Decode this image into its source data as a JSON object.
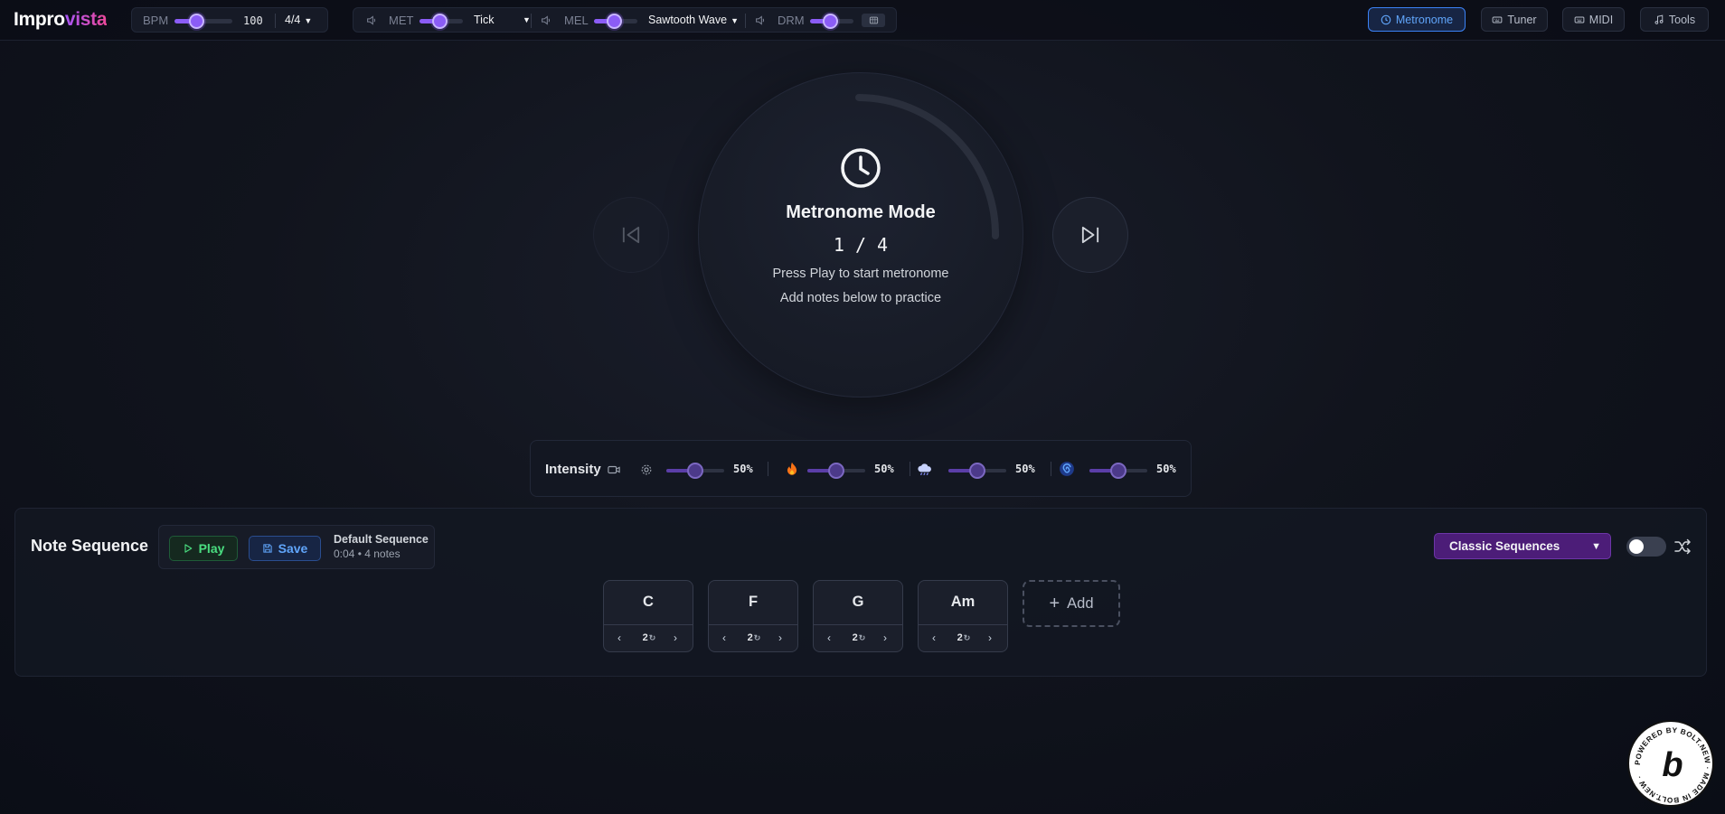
{
  "app": {
    "title_part1": "Impro",
    "title_part2": "vista"
  },
  "top": {
    "bpm_label": "BPM",
    "bpm_value": "100",
    "bpm_level": 0.4,
    "time_signature": "4/4",
    "met_label": "MET",
    "met_sound": "Tick",
    "met_volume": 0.5,
    "mel_label": "MEL",
    "mel_sound": "Sawtooth Wave",
    "mel_volume": 0.5,
    "drm_label": "DRM",
    "drm_volume": 0.5
  },
  "nav": {
    "metronome": "Metronome",
    "tuner": "Tuner",
    "midi": "MIDI",
    "tools": "Tools"
  },
  "main": {
    "mode_title": "Metronome Mode",
    "counter": "1 / 4",
    "hint_1": "Press Play to start metronome",
    "hint_2": "Add notes below to practice"
  },
  "intensity": {
    "label": "Intensity",
    "controls": [
      {
        "icon": "gear-icon",
        "value": "50%",
        "level": 0.5
      },
      {
        "icon": "fire-icon",
        "value": "50%",
        "level": 0.5
      },
      {
        "icon": "cloud-icon",
        "value": "50%",
        "level": 0.5
      },
      {
        "icon": "spiral-icon",
        "value": "50%",
        "level": 0.5
      }
    ]
  },
  "sequence": {
    "title": "Note Sequence",
    "play_label": "Play",
    "save_label": "Save",
    "name": "Default Sequence",
    "meta": "0:04 • 4 notes",
    "preset": "Classic Sequences",
    "add_label": "Add",
    "notes": [
      {
        "name": "C",
        "count": "2"
      },
      {
        "name": "F",
        "count": "2"
      },
      {
        "name": "G",
        "count": "2"
      },
      {
        "name": "Am",
        "count": "2"
      }
    ]
  },
  "colors": {
    "accent": "#8b5cf6",
    "active_nav": "#60a5fa",
    "play_green": "#4ade80",
    "preset_purple": "#4c1d78"
  }
}
